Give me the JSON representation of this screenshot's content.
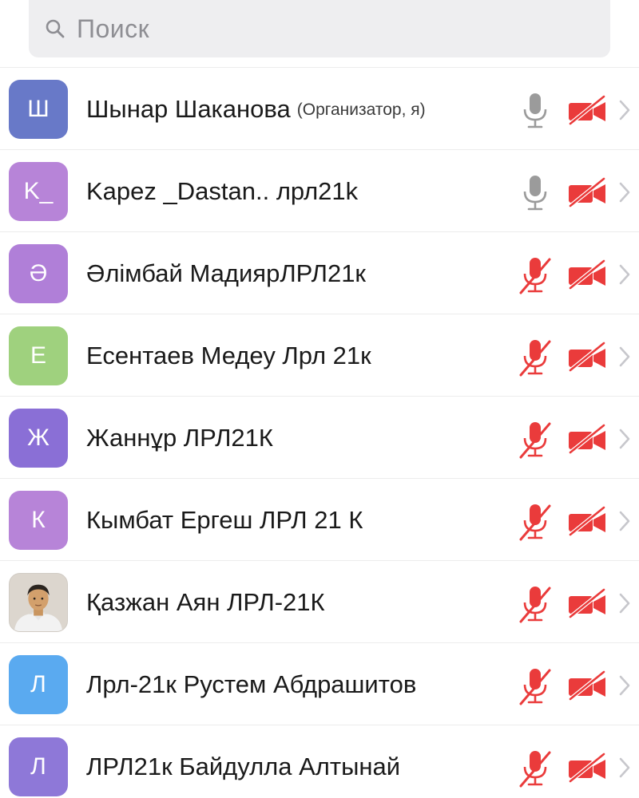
{
  "search": {
    "placeholder": "Поиск",
    "icon": "search-icon"
  },
  "colors": {
    "muted_red": "#ea3b3b",
    "mic_gray": "#9b9b9b",
    "search_bg": "#eeeef0",
    "chevron": "#c7c7cc"
  },
  "participants": [
    {
      "initial": "Ш",
      "name": "Шынар Шаканова",
      "role": "(Организатор, я)",
      "color": "#6879c8",
      "mic": "on",
      "video": "off"
    },
    {
      "initial": "K_",
      "name": "Kapez _Dastan.. лрл21k",
      "role": "",
      "color": "#b784d8",
      "mic": "on",
      "video": "off"
    },
    {
      "initial": "Ә",
      "name": "Әлімбай МадиярЛРЛ21к",
      "role": "",
      "color": "#b07fd8",
      "mic": "off",
      "video": "off"
    },
    {
      "initial": "Е",
      "name": "Есентаев Медеу Лрл 21к",
      "role": "",
      "color": "#9fd17e",
      "mic": "off",
      "video": "off"
    },
    {
      "initial": "Ж",
      "name": "Жаннұр ЛРЛ21К",
      "role": "",
      "color": "#8a6fd6",
      "mic": "off",
      "video": "off"
    },
    {
      "initial": "К",
      "name": "Кымбат Ергеш ЛРЛ 21 К",
      "role": "",
      "color": "#b784d8",
      "mic": "off",
      "video": "off"
    },
    {
      "initial": "",
      "name": "Қазжан Аян ЛРЛ-21К",
      "role": "",
      "color": "#d9d3cb",
      "mic": "off",
      "video": "off",
      "avatar": "photo"
    },
    {
      "initial": "Л",
      "name": "Лрл-21к Рустем Абдрашитов",
      "role": "",
      "color": "#5aaaf0",
      "mic": "off",
      "video": "off"
    },
    {
      "initial": "Л",
      "name": "ЛРЛ21к Байдулла Алтынай",
      "role": "",
      "color": "#8e78d8",
      "mic": "off",
      "video": "off"
    }
  ]
}
